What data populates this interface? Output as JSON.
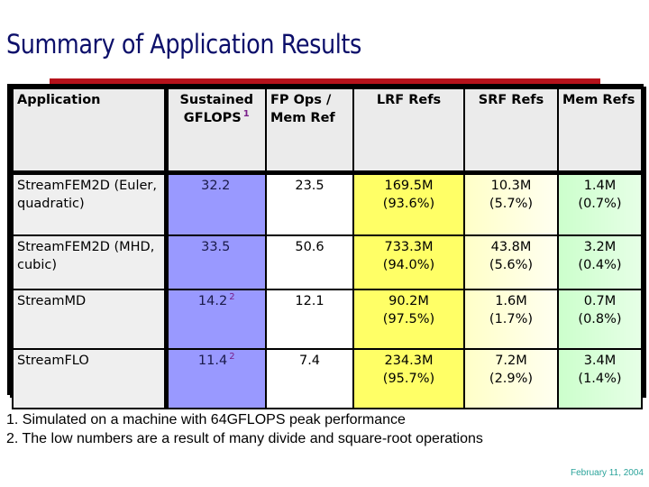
{
  "slide": {
    "title": "Summary of Application Results",
    "accent_color": "#b5121b",
    "title_color": "#0c0f6a"
  },
  "table": {
    "headers": {
      "application": "Application",
      "gflops": "Sustained GFLOPS",
      "gflops_footnote": "1",
      "fpops": "FP Ops / Mem Ref",
      "lrf": "LRF Refs",
      "srf": "SRF Refs",
      "mem": "Mem Refs"
    },
    "rows": [
      {
        "application": "StreamFEM2D (Euler, quadratic)",
        "gflops": "32.2",
        "gflops_footnote": "",
        "fpops": "23.5",
        "lrf_count": "169.5M",
        "lrf_pct": "(93.6%)",
        "srf_count": "10.3M",
        "srf_pct": "(5.7%)",
        "mem_count": "1.4M",
        "mem_pct": "(0.7%)"
      },
      {
        "application": "StreamFEM2D (MHD, cubic)",
        "gflops": "33.5",
        "gflops_footnote": "",
        "fpops": "50.6",
        "lrf_count": "733.3M",
        "lrf_pct": "(94.0%)",
        "srf_count": "43.8M",
        "srf_pct": "(5.6%)",
        "mem_count": "3.2M",
        "mem_pct": "(0.4%)"
      },
      {
        "application": "StreamMD",
        "gflops": "14.2",
        "gflops_footnote": "2",
        "fpops": "12.1",
        "lrf_count": "90.2M",
        "lrf_pct": "(97.5%)",
        "srf_count": "1.6M",
        "srf_pct": "(1.7%)",
        "mem_count": "0.7M",
        "mem_pct": "(0.8%)"
      },
      {
        "application": "StreamFLO",
        "gflops": "11.4",
        "gflops_footnote": "2",
        "fpops": "7.4",
        "lrf_count": "234.3M",
        "lrf_pct": "(95.7%)",
        "srf_count": "7.2M",
        "srf_pct": "(2.9%)",
        "mem_count": "3.4M",
        "mem_pct": "(1.4%)"
      }
    ],
    "colors": {
      "header_bg": "#ebebeb",
      "application_bg": "#efefef",
      "gflops_bg": "#9999ff",
      "fpops_bg": "#ffffff",
      "lrf_bg": "#ffff66",
      "srf_bg": "#ffffc8",
      "mem_bg": "#ccffcc"
    }
  },
  "footnotes": [
    "1. Simulated on a machine with 64GFLOPS peak performance",
    "2. The low numbers are a result of many divide and square-root operations"
  ],
  "footer": {
    "date": "February 11, 2004"
  }
}
